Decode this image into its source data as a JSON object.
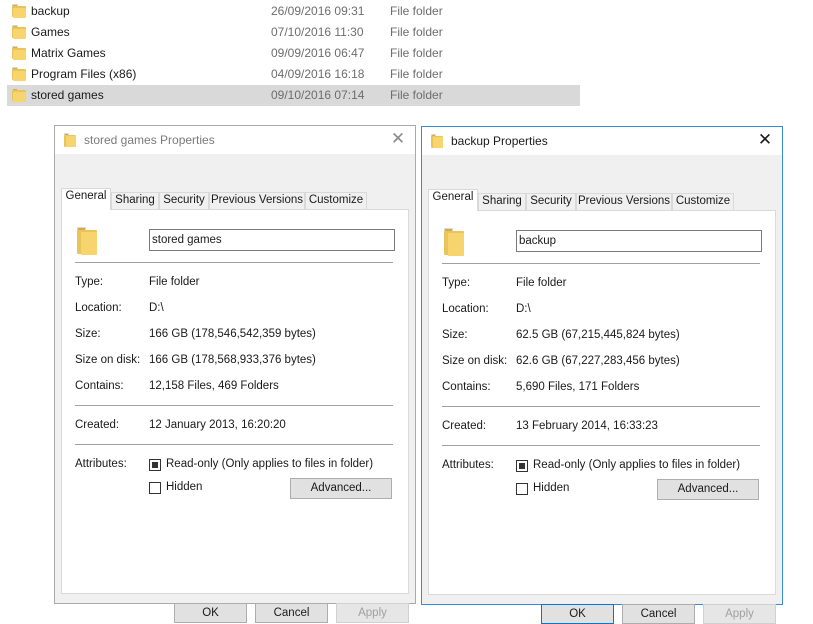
{
  "files": [
    {
      "name": "backup",
      "date": "26/09/2016 09:31",
      "type": "File folder",
      "selected": false
    },
    {
      "name": "Games",
      "date": "07/10/2016 11:30",
      "type": "File folder",
      "selected": false
    },
    {
      "name": "Matrix Games",
      "date": "09/09/2016 06:47",
      "type": "File folder",
      "selected": false
    },
    {
      "name": "Program Files (x86)",
      "date": "04/09/2016 16:18",
      "type": "File folder",
      "selected": false
    },
    {
      "name": "stored games",
      "date": "09/10/2016 07:14",
      "type": "File folder",
      "selected": true
    }
  ],
  "dialogs": [
    {
      "title": "stored games Properties",
      "active": false,
      "tabs": [
        "General",
        "Sharing",
        "Security",
        "Previous Versions",
        "Customize"
      ],
      "selected_tab": "General",
      "folder_name": "stored games",
      "type_label": "Type:",
      "type_value": "File folder",
      "location_label": "Location:",
      "location_value": "D:\\",
      "size_label": "Size:",
      "size_value": "166 GB (178,546,542,359 bytes)",
      "size_on_disk_label": "Size on disk:",
      "size_on_disk_value": "166 GB (178,568,933,376 bytes)",
      "contains_label": "Contains:",
      "contains_value": "12,158 Files, 469 Folders",
      "created_label": "Created:",
      "created_value": "12 January 2013, 16:20:20",
      "attributes_label": "Attributes:",
      "readonly_label": "Read-only (Only applies to files in folder)",
      "readonly_checked": true,
      "hidden_label": "Hidden",
      "hidden_checked": false,
      "advanced_label": "Advanced...",
      "ok_label": "OK",
      "cancel_label": "Cancel",
      "apply_label": "Apply"
    },
    {
      "title": "backup Properties",
      "active": true,
      "tabs": [
        "General",
        "Sharing",
        "Security",
        "Previous Versions",
        "Customize"
      ],
      "selected_tab": "General",
      "folder_name": "backup",
      "type_label": "Type:",
      "type_value": "File folder",
      "location_label": "Location:",
      "location_value": "D:\\",
      "size_label": "Size:",
      "size_value": "62.5 GB (67,215,445,824 bytes)",
      "size_on_disk_label": "Size on disk:",
      "size_on_disk_value": "62.6 GB (67,227,283,456 bytes)",
      "contains_label": "Contains:",
      "contains_value": "5,690 Files, 171 Folders",
      "created_label": "Created:",
      "created_value": "13 February 2014, 16:33:23",
      "attributes_label": "Attributes:",
      "readonly_label": "Read-only (Only applies to files in folder)",
      "readonly_checked": true,
      "hidden_label": "Hidden",
      "hidden_checked": false,
      "advanced_label": "Advanced...",
      "ok_label": "OK",
      "cancel_label": "Cancel",
      "apply_label": "Apply"
    }
  ],
  "colors": {
    "selection": "#d9d9d9",
    "active_border": "#3a8ad6",
    "folder": "#f7d46d"
  },
  "icons": {
    "folder": "folder-icon",
    "close": "close-icon"
  }
}
